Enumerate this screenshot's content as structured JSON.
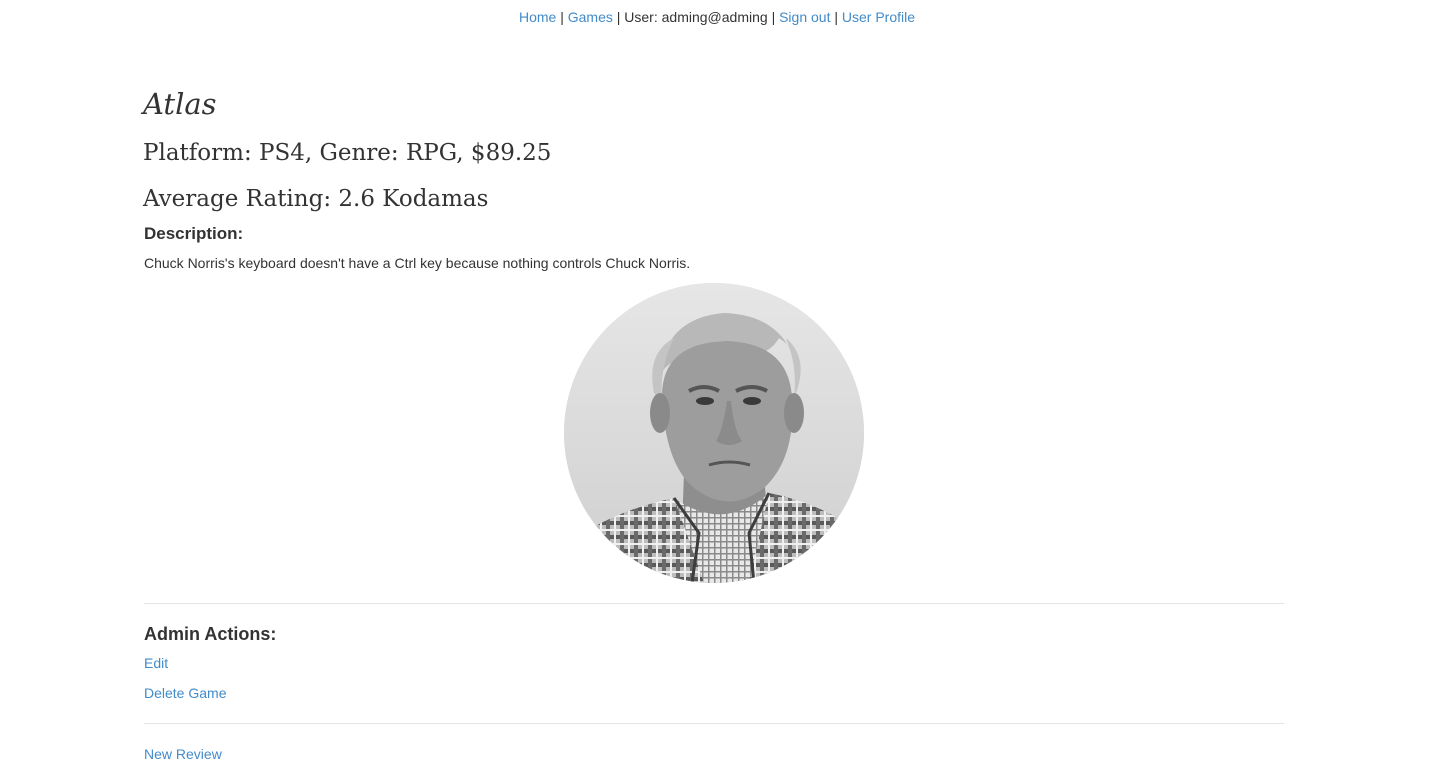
{
  "nav": {
    "home": "Home",
    "games": "Games",
    "user_label": "User: adming@adming",
    "sign_out": "Sign out",
    "user_profile": "User Profile",
    "separator": "|"
  },
  "game": {
    "title": "Atlas",
    "platform_line": "Platform: PS4, Genre: RPG, $89.25",
    "rating_line": "Average Rating: 2.6 Kodamas"
  },
  "description": {
    "heading": "Description:",
    "text": "Chuck Norris's keyboard doesn't have a Ctrl key because nothing controls Chuck Norris."
  },
  "admin": {
    "heading": "Admin Actions:",
    "edit": "Edit",
    "delete": "Delete Game"
  },
  "reviews": {
    "new_review": "New Review"
  },
  "colors": {
    "link": "#428bca",
    "text": "#333333",
    "rule": "#e5e5e5"
  }
}
